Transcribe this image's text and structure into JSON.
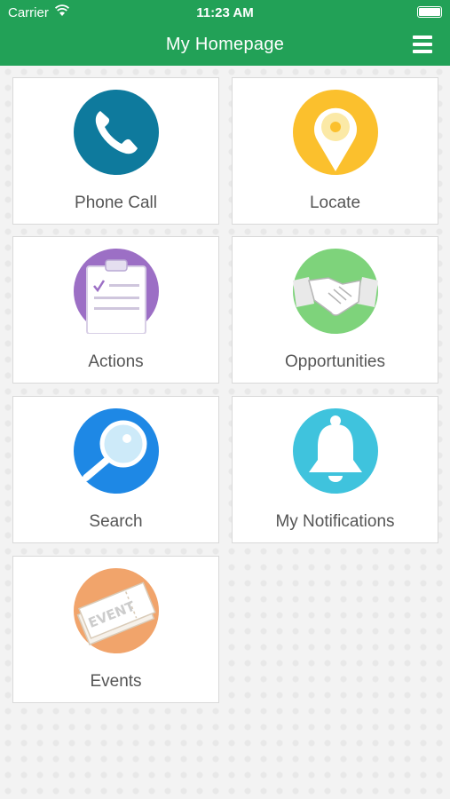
{
  "status_bar": {
    "carrier": "Carrier",
    "time": "11:23 AM"
  },
  "navbar": {
    "title": "My Homepage",
    "menu_icon": "hamburger-menu-icon"
  },
  "tiles": [
    {
      "label": "Phone Call",
      "icon": "phone-icon",
      "color": "#0e7a9d"
    },
    {
      "label": "Locate",
      "icon": "location-pin-icon",
      "color": "#fbc02d"
    },
    {
      "label": "Actions",
      "icon": "clipboard-checklist-icon",
      "color": "#9c6fc5"
    },
    {
      "label": "Opportunities",
      "icon": "handshake-icon",
      "color": "#7ed37b"
    },
    {
      "label": "Search",
      "icon": "magnifier-icon",
      "color": "#1e88e5"
    },
    {
      "label": "My Notifications",
      "icon": "bell-icon",
      "color": "#3fc3dd"
    },
    {
      "label": "Events",
      "icon": "event-ticket-icon",
      "color": "#f1a46b"
    }
  ],
  "colors": {
    "header": "#22a157",
    "background": "#f3f3f3"
  }
}
